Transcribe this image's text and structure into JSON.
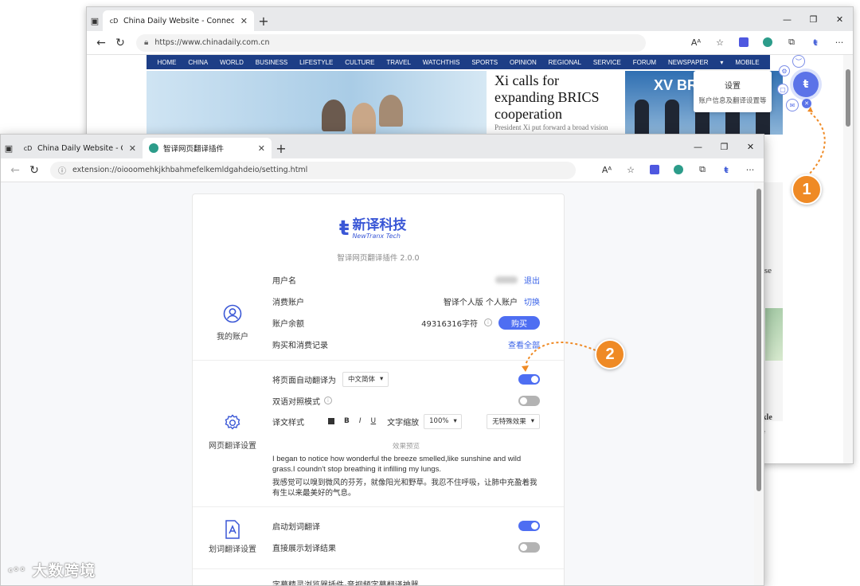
{
  "back_browser": {
    "tab_title": "China Daily Website - Connectin",
    "url": "https://www.chinadaily.com.cn",
    "nav_items": [
      "HOME",
      "CHINA",
      "WORLD",
      "BUSINESS",
      "LIFESTYLE",
      "CULTURE",
      "TRAVEL",
      "WATCHTHIS",
      "SPORTS",
      "OPINION",
      "REGIONAL",
      "SERVICE",
      "FORUM",
      "NEWSPAPER",
      "▾",
      "MOBILE"
    ],
    "headline": "Xi calls for expanding BRICS cooperation",
    "subhead": "President Xi put forward a broad vision",
    "photo_text": "XV BRI",
    "tooltip_title": "设置",
    "tooltip_desc": "账户信息及翻译设置等",
    "partial_text_1": "ase",
    "partial_text_2": "kle",
    "partial_text_3": "e"
  },
  "front_browser": {
    "tab1_title": "China Daily Website - Connectin",
    "tab2_title": "智译网页翻译插件",
    "url": "extension://oiooomehkjkhbahmefelkemldgahdeio/setting.html"
  },
  "settings": {
    "logo_cn": "新译科技",
    "logo_en": "NewTranx Tech",
    "version": "智译网页翻译插件 2.0.0",
    "account": {
      "section_label": "我的账户",
      "username_label": "用户名",
      "logout": "退出",
      "plan_label": "消费账户",
      "plan_value": "智译个人版 个人账户",
      "switch": "切换",
      "balance_label": "账户余额",
      "balance_value": "49316316字符",
      "buy": "购买",
      "records_label": "购买和消费记录",
      "view_all": "查看全部"
    },
    "translate": {
      "section_label": "网页翻译设置",
      "auto_label": "将页面自动翻译为",
      "auto_lang": "中文简体",
      "bilingual_label": "双语对照模式",
      "style_label": "译文样式",
      "fmt_bold": "B",
      "fmt_italic": "I",
      "fmt_underline": "U",
      "zoom_label": "文字缩放",
      "zoom_value": "100%",
      "effect_value": "无特殊效果",
      "preview_title": "效果预览",
      "preview_en": "I began to notice how wonderful the breeze smelled,like sunshine and wild grass.I coundn't stop breathing it infilling my lungs.",
      "preview_cn": "我感觉可以嗅到微风的芬芳，就像阳光和野草。我忍不住呼吸，让肺中充盈着我有生以来最美好的气息。"
    },
    "word": {
      "section_label": "划词翻译设置",
      "enable_label": "启动划词翻译",
      "direct_label": "直接展示划译结果"
    },
    "footer_text": "字幕精灵浏览器插件-音视频字幕翻译神器"
  },
  "callouts": {
    "one": "1",
    "two": "2"
  },
  "watermark": "大数跨境",
  "toggles": {
    "auto_translate": true,
    "bilingual": false,
    "word_enable": true,
    "word_direct": false
  },
  "colors": {
    "accent": "#4e6ef2",
    "callout": "#ef8a25",
    "nav": "#1d3e86"
  }
}
